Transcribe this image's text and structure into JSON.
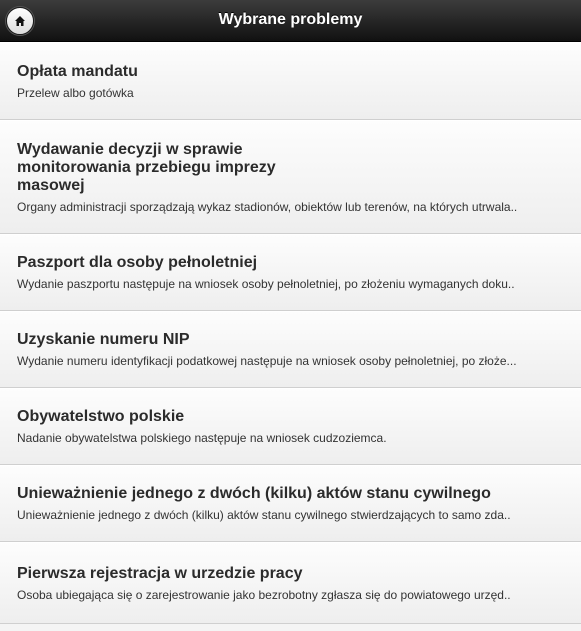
{
  "header": {
    "title": "Wybrane problemy",
    "home_icon": "home-icon"
  },
  "items": [
    {
      "title": "Opłata mandatu",
      "desc": "Przelew albo gotówka"
    },
    {
      "title": "Wydawanie decyzji w sprawie monitorowania przebiegu imprezy masowej",
      "desc": "Organy administracji sporządzają wykaz stadionów, obiektów lub terenów, na których utrwala.."
    },
    {
      "title": "Paszport dla osoby pełnoletniej",
      "desc": "Wydanie paszportu następuje na wniosek osoby pełnoletniej, po złożeniu wymaganych doku.."
    },
    {
      "title": "Uzyskanie numeru NIP",
      "desc": "Wydanie numeru identyfikacji podatkowej następuje na wniosek osoby pełnoletniej, po złoże..."
    },
    {
      "title": "Obywatelstwo polskie",
      "desc": "Nadanie obywatelstwa polskiego następuje na wniosek cudzoziemca."
    },
    {
      "title": "Unieważnienie jednego z dwóch (kilku) aktów stanu cywilnego",
      "desc": "Unieważnienie jednego z dwóch (kilku) aktów stanu cywilnego stwierdzających to samo zda.."
    },
    {
      "title": "Pierwsza rejestracja w urzedzie pracy",
      "desc": "Osoba ubiegająca się o zarejestrowanie jako bezrobotny zgłasza się do powiatowego urzęd.."
    }
  ]
}
